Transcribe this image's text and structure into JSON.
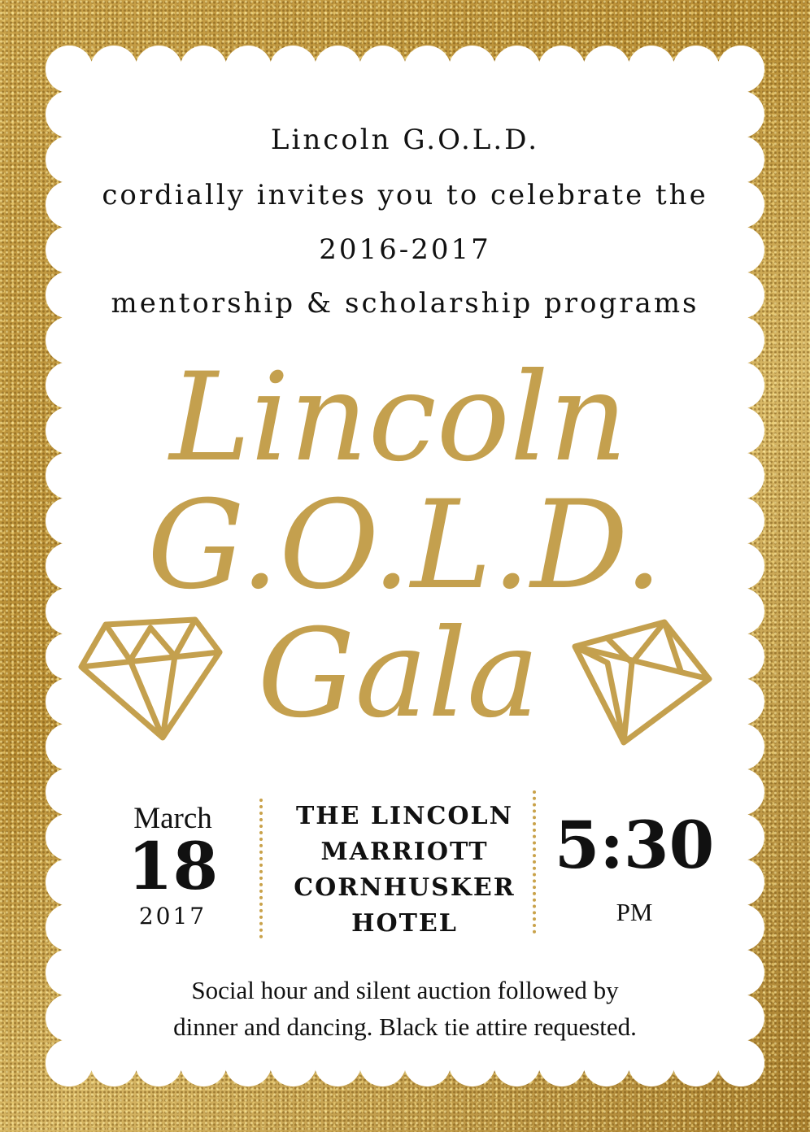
{
  "intro": {
    "line1": "Lincoln G.O.L.D.",
    "line2": "cordially invites you to celebrate the",
    "line3": "2016-2017",
    "line4": "mentorship & scholarship programs"
  },
  "title": {
    "line1": "Lincoln",
    "line2": "G.O.L.D.",
    "line3": "Gala"
  },
  "date": {
    "month": "March",
    "day": "18",
    "year": "2017"
  },
  "venue": {
    "line1": "THE LINCOLN",
    "line2": "MARRIOTT",
    "line3": "CORNHUSKER",
    "line4": "HOTEL"
  },
  "time": {
    "value": "5:30",
    "period": "PM"
  },
  "footer": {
    "line1": "Social hour and silent auction followed by",
    "line2": "dinner and dancing. Black tie attire requested."
  },
  "colors": {
    "gold": "#c4a04e",
    "text": "#111111",
    "card": "#ffffff"
  },
  "icons": [
    "diamond-icon",
    "diamond-icon"
  ]
}
